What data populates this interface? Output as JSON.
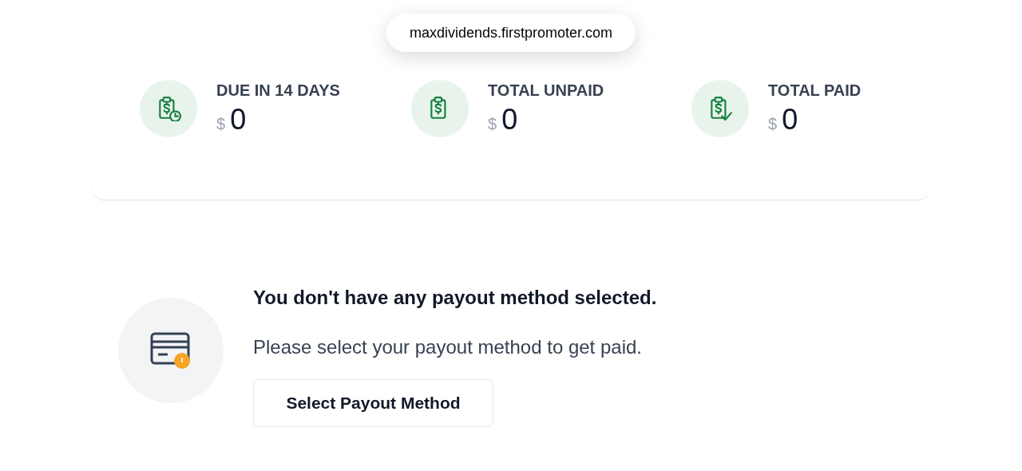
{
  "address_bar": {
    "url": "maxdividends.firstpromoter.com"
  },
  "stats": [
    {
      "kind": "clock",
      "label": "DUE IN 14 DAYS",
      "currency": "$",
      "value": "0"
    },
    {
      "kind": "plain",
      "label": "TOTAL UNPAID",
      "currency": "$",
      "value": "0"
    },
    {
      "kind": "check",
      "label": "TOTAL PAID",
      "currency": "$",
      "value": "0"
    }
  ],
  "payout": {
    "title": "You don't have any payout method selected.",
    "message": "Please select your payout method to get paid.",
    "button": "Select Payout Method"
  }
}
